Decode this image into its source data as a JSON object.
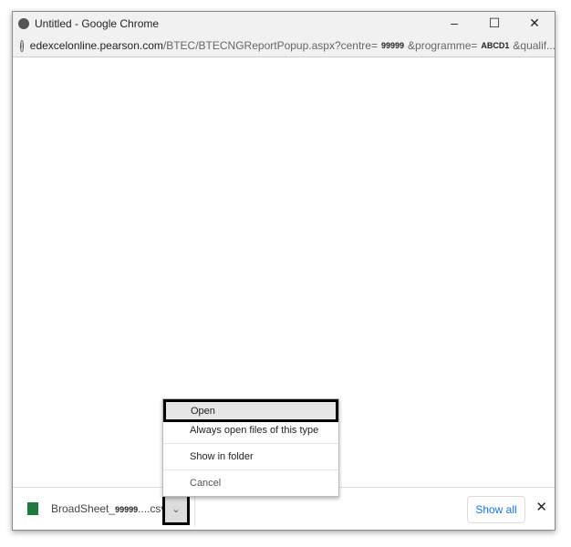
{
  "window": {
    "title": "Untitled - Google Chrome",
    "controls": [
      "–",
      "☐",
      "✕"
    ]
  },
  "address": {
    "host": "edexcelonline.pearson.com",
    "path": "/BTEC/BTECNGReportPopup.aspx?centre=",
    "centre": "99999",
    "programme_label": "&programme=",
    "programme": "ABCD1",
    "rest": "&qualif..."
  },
  "download": {
    "file_prefix": "BroadSheet_",
    "file_id": "99999",
    "file_suffix": "....csv",
    "show_all": "Show all",
    "close": "✕",
    "chevron": "⌄"
  },
  "menu": {
    "items": [
      "Open",
      "Always open files of this type",
      "Show in folder",
      "Cancel"
    ]
  }
}
